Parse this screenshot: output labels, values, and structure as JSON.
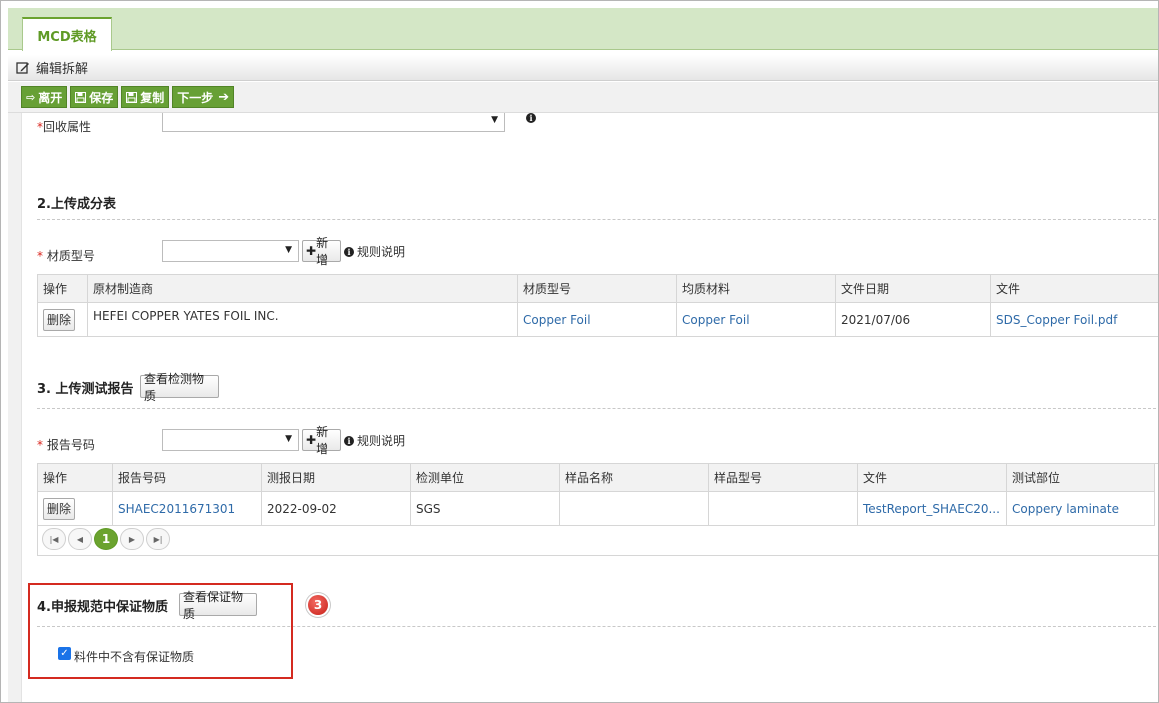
{
  "tab": {
    "label": "MCD表格"
  },
  "titlebar": {
    "label": "编辑拆解"
  },
  "toolbar": {
    "leave": "离开",
    "save": "保存",
    "copy": "复制",
    "next": "下一步"
  },
  "section1": {
    "recycle_label": "回收属性",
    "recycle_value": ""
  },
  "section2": {
    "title": "2.上传成分表",
    "material_label": "材质型号",
    "material_value": "",
    "add_label": "新增",
    "rule_label": "规则说明",
    "table": {
      "headers": [
        "操作",
        "原材制造商",
        "材质型号",
        "均质材料",
        "文件日期",
        "文件"
      ],
      "rows": [
        {
          "action": "删除",
          "manufacturer": "HEFEI COPPER YATES FOIL INC.",
          "model": "Copper Foil",
          "homogeneous": "Copper Foil",
          "date": "2021/07/06",
          "file": "SDS_Copper Foil.pdf"
        }
      ]
    }
  },
  "section3": {
    "title": "3. 上传测试报告",
    "view_button": "查看检测物质",
    "report_label": "报告号码",
    "report_value": "",
    "add_label": "新增",
    "rule_label": "规则说明",
    "table": {
      "headers": [
        "操作",
        "报告号码",
        "测报日期",
        "检测单位",
        "样品名称",
        "样品型号",
        "文件",
        "测试部位"
      ],
      "rows": [
        {
          "action": "删除",
          "report_no": "SHAEC2011671301",
          "date": "2022-09-02",
          "lab": "SGS",
          "sample_name": "",
          "sample_model": "",
          "file": "TestReport_SHAEC20...",
          "part": "Coppery laminate"
        }
      ]
    },
    "pager": {
      "current_page": "1"
    }
  },
  "section4": {
    "title": "4.申报规范中保证物质",
    "view_button": "查看保证物质",
    "checkbox_label": "料件中不含有保证物质",
    "checkbox_checked": true,
    "badge": "3"
  },
  "colors": {
    "accent": "#6ba32f",
    "highlight": "#d42a20",
    "link": "#2e6aa8"
  }
}
